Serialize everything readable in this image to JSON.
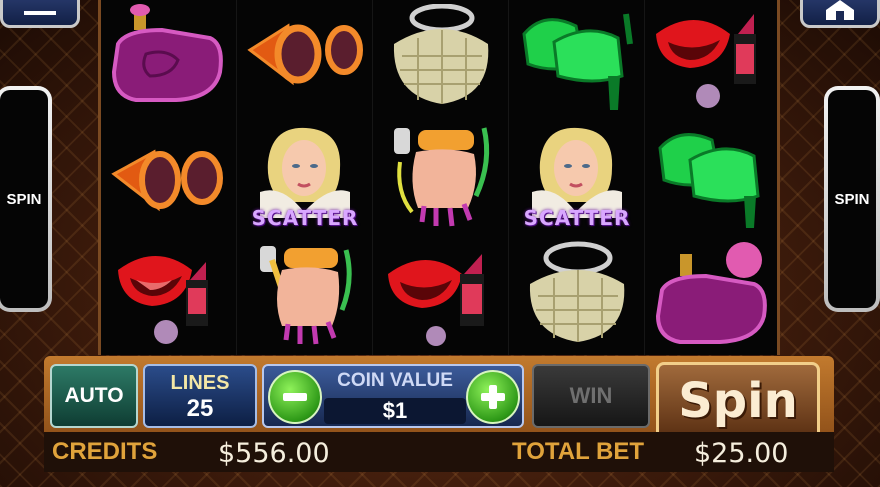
{
  "side_buttons": {
    "left_label": "SPIN",
    "right_label": "SPIN"
  },
  "top_buttons": {
    "left_icon": "menu-icon",
    "right_icon": "home-icon"
  },
  "reels": [
    [
      "perfume",
      "sunglasses",
      "lips-lipstick"
    ],
    [
      "sunglasses",
      "scatter-woman",
      "hand-nails"
    ],
    [
      "handbag",
      "hand-nails",
      "lips-lipstick"
    ],
    [
      "green-shoes",
      "scatter-woman",
      "handbag"
    ],
    [
      "lips-lipstick",
      "green-shoes",
      "perfume"
    ]
  ],
  "scatter_label": "SCATTER",
  "controls": {
    "auto_label": "AUTO",
    "lines_label": "LINES",
    "lines_value": "25",
    "coin_value_label": "COIN VALUE",
    "coin_value": "$1",
    "win_label": "WIN",
    "spin_label": "Spin"
  },
  "status": {
    "credits_label": "CREDITS",
    "credits_value": "$556.00",
    "total_bet_label": "TOTAL BET",
    "total_bet_value": "$25.00"
  }
}
